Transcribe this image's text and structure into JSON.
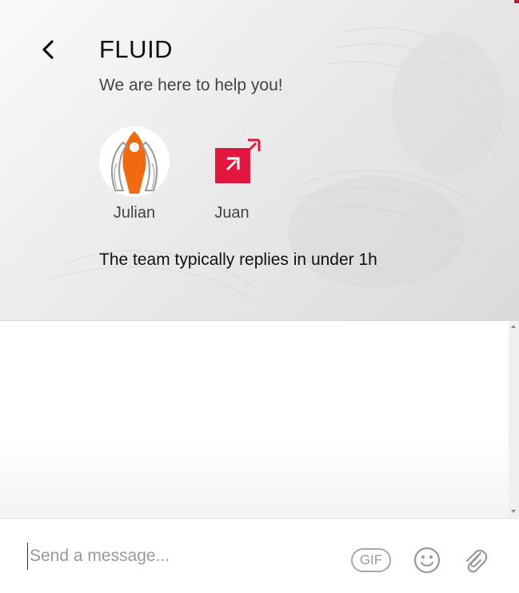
{
  "header": {
    "title": "FLUID",
    "subtitle": "We are here to help you!",
    "reply_time": "The team typically replies in under 1h",
    "agents": [
      {
        "name": "Julian",
        "avatar_icon": "rocket-icon"
      },
      {
        "name": "Juan",
        "avatar_icon": "red-arrow-logo-icon"
      }
    ]
  },
  "composer": {
    "placeholder": "Send a message...",
    "gif_label": "GIF"
  },
  "colors": {
    "accent_red": "#e3173e",
    "rocket_orange": "#f26a10"
  }
}
